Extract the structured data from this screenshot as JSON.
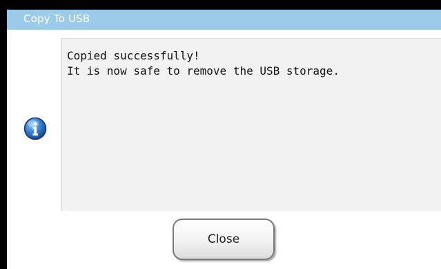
{
  "dialog": {
    "title": "Copy To USB",
    "message_lines": [
      "Copied successfully!",
      "It is now safe to remove the USB storage."
    ],
    "icon": "info-icon",
    "close_label": "Close"
  },
  "colors": {
    "titlebar": "#9ccbea",
    "frame": "#000000",
    "message_bg": "#f2f2f2",
    "icon_blue": "#1d5fb4"
  }
}
